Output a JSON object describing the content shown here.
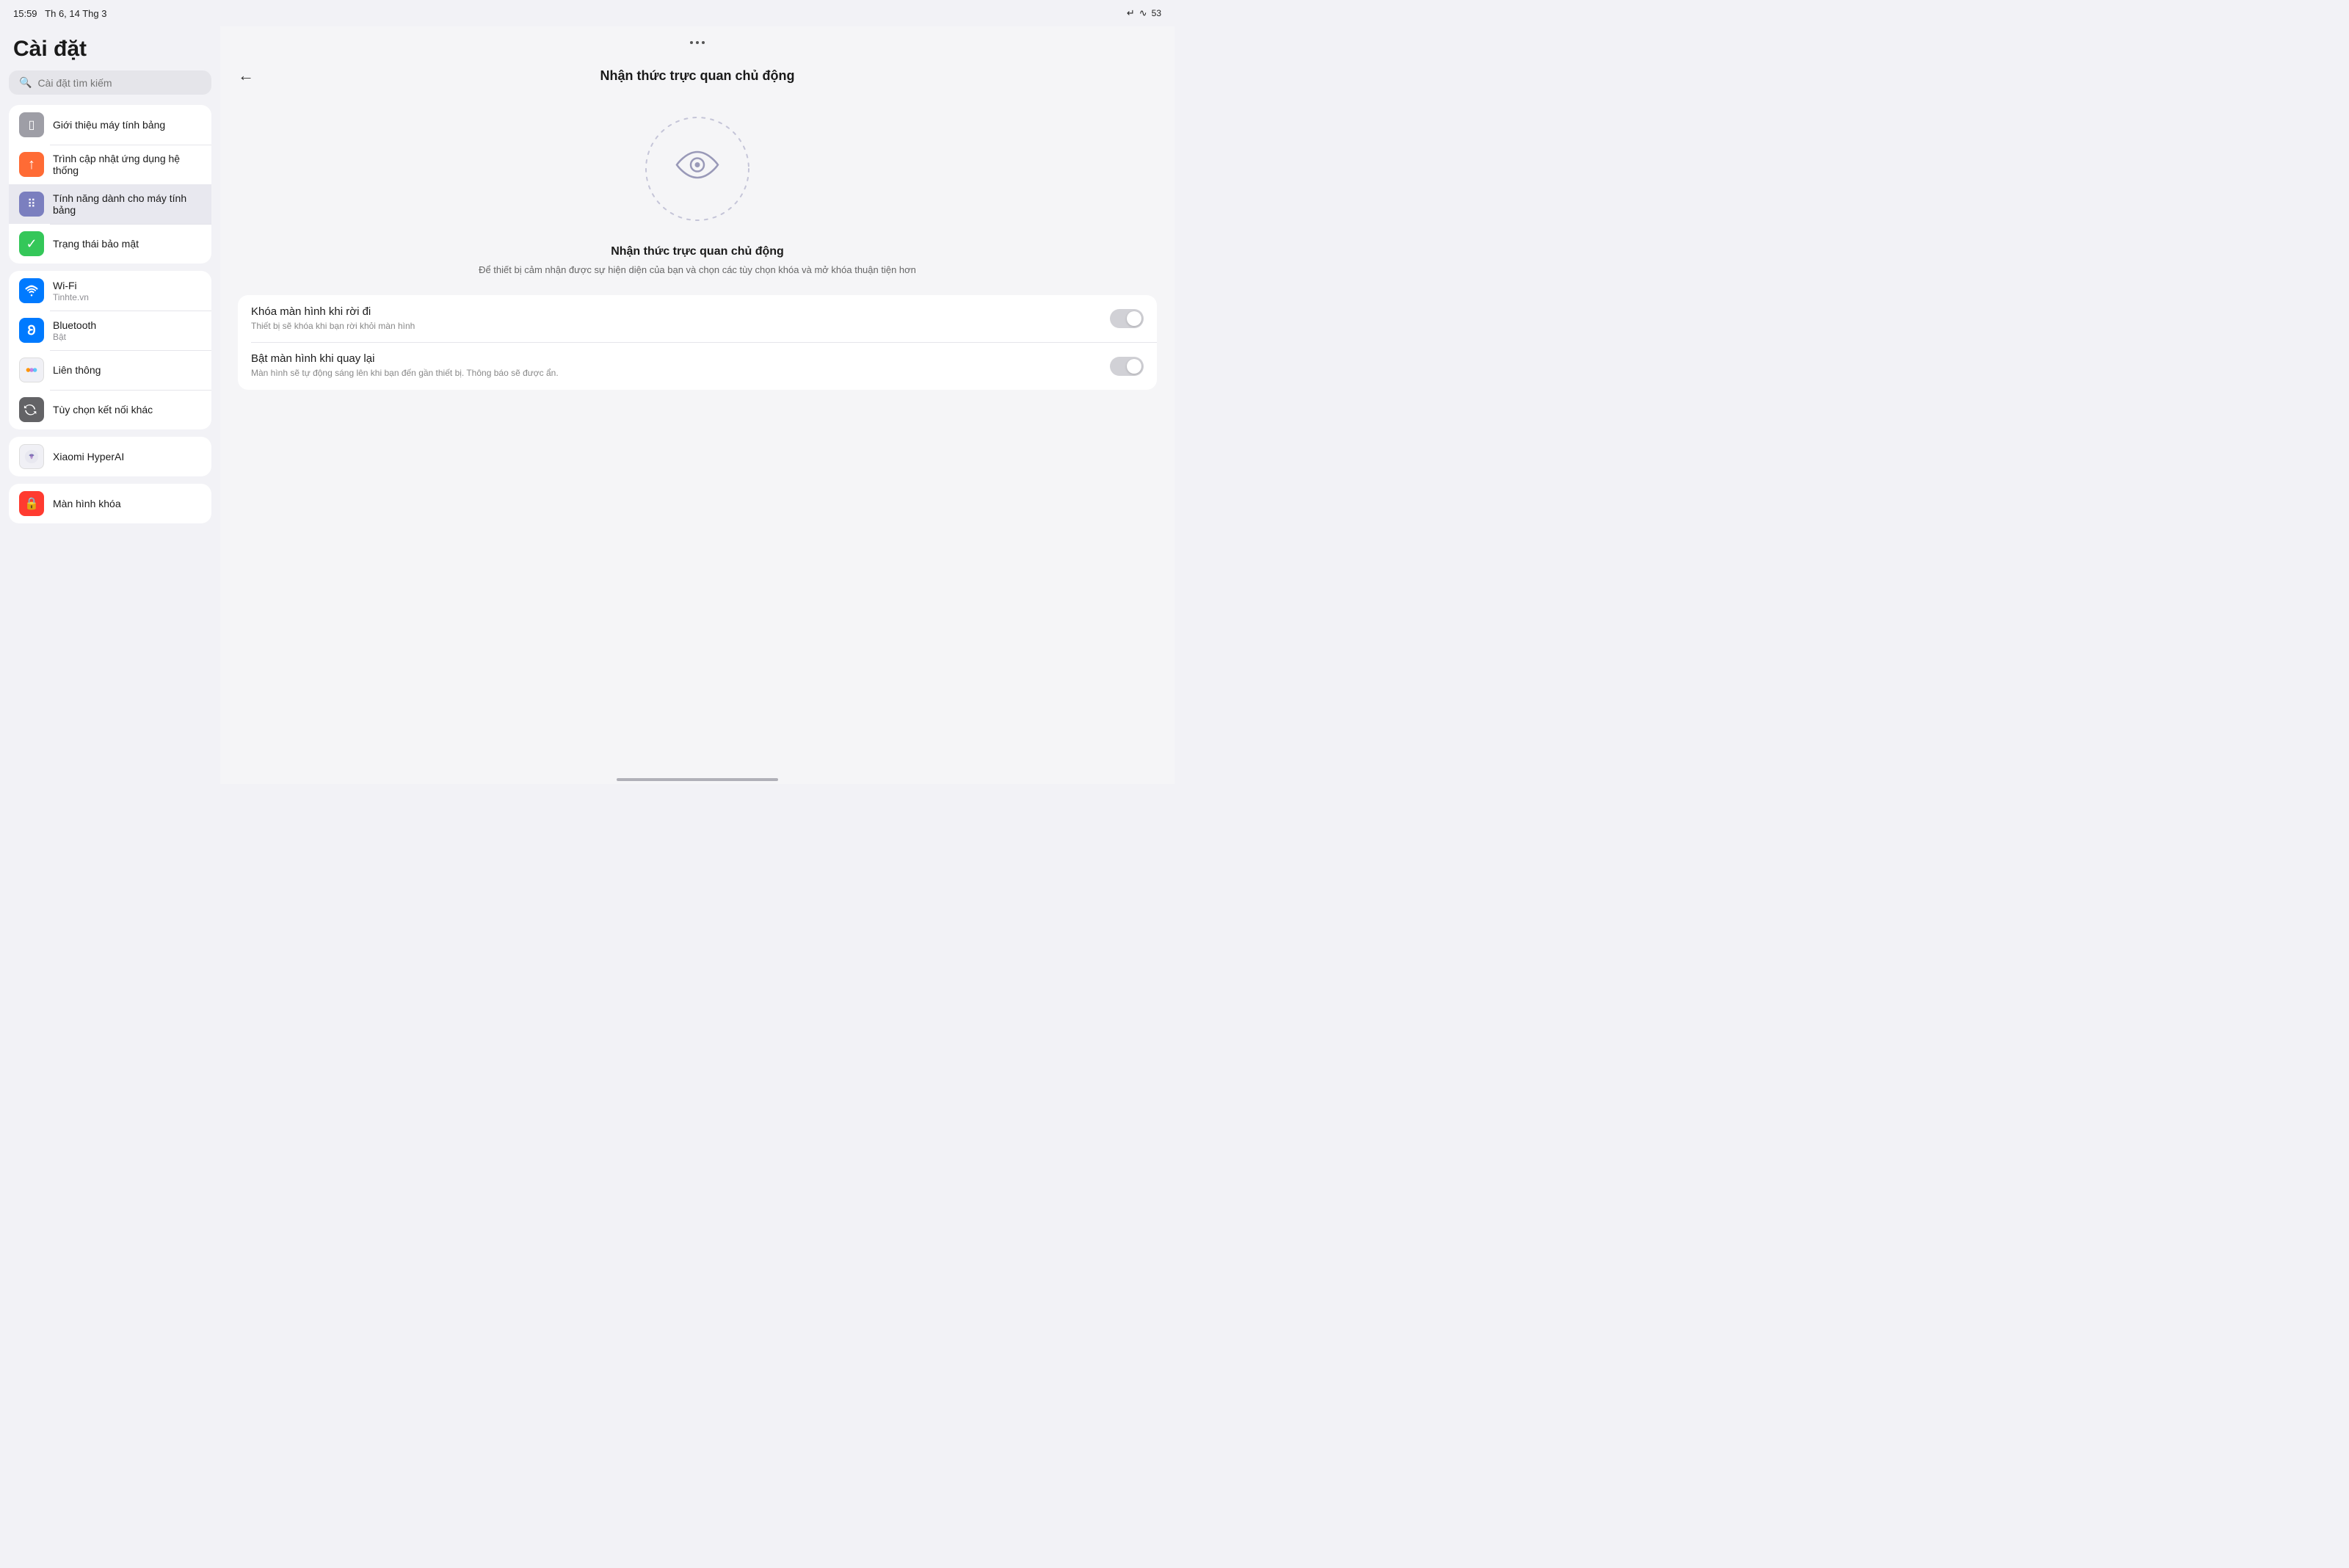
{
  "statusBar": {
    "time": "15:59",
    "date": "Th 6, 14 Thg 3",
    "battery": "53",
    "batteryIcon": "🔋"
  },
  "leftPanel": {
    "title": "Cài đặt",
    "search": {
      "placeholder": "Cài đặt tìm kiếm"
    },
    "groups": [
      {
        "items": [
          {
            "id": "intro",
            "label": "Giới thiệu máy tính bảng",
            "sublabel": "",
            "iconColor": "icon-gray",
            "iconSymbol": "▣",
            "active": false
          },
          {
            "id": "update",
            "label": "Trình cập nhật ứng dụng hệ thống",
            "sublabel": "",
            "iconColor": "icon-orange",
            "iconSymbol": "↑",
            "active": false
          },
          {
            "id": "tablet-features",
            "label": "Tính năng dành cho máy tính bảng",
            "sublabel": "",
            "iconColor": "icon-purple",
            "iconSymbol": "⠿",
            "active": true
          },
          {
            "id": "security",
            "label": "Trạng thái bảo mật",
            "sublabel": "",
            "iconColor": "icon-green",
            "iconSymbol": "✓",
            "active": false
          }
        ]
      },
      {
        "items": [
          {
            "id": "wifi",
            "label": "Wi-Fi",
            "sublabel": "Tinhte.vn",
            "iconColor": "icon-blue-wifi",
            "iconSymbol": "wifi",
            "active": false
          },
          {
            "id": "bluetooth",
            "label": "Bluetooth",
            "sublabel": "Bật",
            "iconColor": "icon-blue-bt",
            "iconSymbol": "bt",
            "active": false
          },
          {
            "id": "lien-thong",
            "label": "Liên thông",
            "sublabel": "",
            "iconColor": "icon-lien",
            "iconSymbol": "lien",
            "active": false
          },
          {
            "id": "other-connect",
            "label": "Tùy chọn kết nối khác",
            "sublabel": "",
            "iconColor": "icon-other",
            "iconSymbol": "S",
            "active": false
          }
        ]
      },
      {
        "items": [
          {
            "id": "hyperai",
            "label": "Xiaomi HyperAI",
            "sublabel": "",
            "iconColor": "icon-hyper",
            "iconSymbol": "AI",
            "active": false
          }
        ]
      },
      {
        "items": [
          {
            "id": "lockscreen",
            "label": "Màn hình khóa",
            "sublabel": "",
            "iconColor": "icon-lock",
            "iconSymbol": "🔒",
            "active": false
          }
        ]
      }
    ]
  },
  "rightPanel": {
    "topbarDots": "···",
    "backLabel": "←",
    "title": "Nhận thức trực quan chủ động",
    "featureTitle": "Nhận thức trực quan chủ động",
    "featureDesc": "Để thiết bị cảm nhận được sự hiện diện của bạn và chọn các tùy chọn khóa và mở khóa thuận tiện hơn",
    "toggles": [
      {
        "id": "lock-on-leave",
        "label": "Khóa màn hình khi rời đi",
        "desc": "Thiết bị sẽ khóa khi bạn rời khỏi màn hình",
        "enabled": false
      },
      {
        "id": "wake-on-return",
        "label": "Bật màn hình khi quay lại",
        "desc": "Màn hình sẽ tự động sáng lên khi bạn đến gần thiết bị. Thông báo sẽ được ẩn.",
        "enabled": false
      }
    ]
  }
}
